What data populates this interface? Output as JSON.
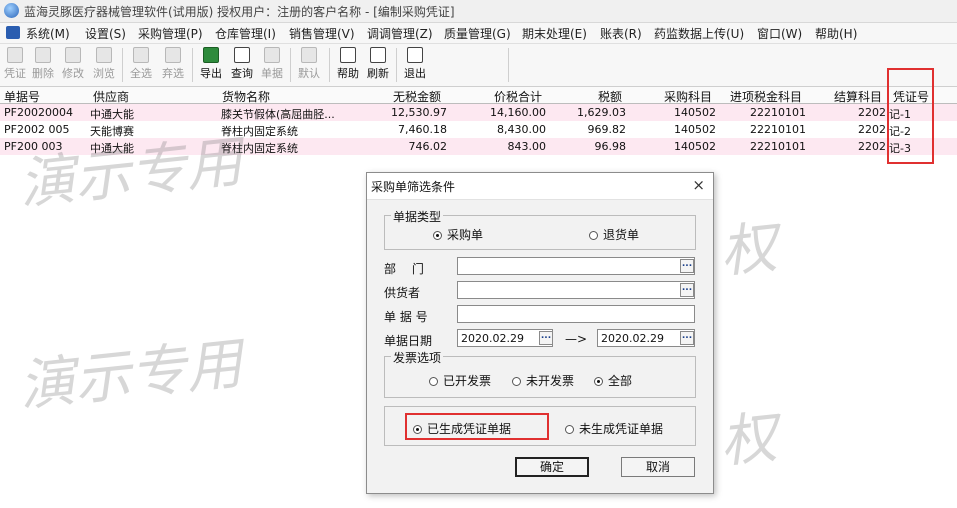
{
  "window": {
    "title": "蓝海灵豚医疗器械管理软件(试用版)    授权用户：注册的客户名称 - [编制采购凭证]"
  },
  "menubar": {
    "items": [
      "系统(M)",
      "设置(S)",
      "采购管理(P)",
      "仓库管理(I)",
      "销售管理(V)",
      "调调管理(Z)",
      "质量管理(G)",
      "期末处理(E)",
      "账表(R)",
      "药监数据上传(U)",
      "窗口(W)",
      "帮助(H)"
    ]
  },
  "toolbar": {
    "buttons": [
      {
        "label": "凭证",
        "icon": "voucher-icon",
        "enabled": false
      },
      {
        "label": "删除",
        "icon": "delete-icon",
        "enabled": false
      },
      {
        "label": "修改",
        "icon": "edit-icon",
        "enabled": false
      },
      {
        "label": "浏览",
        "icon": "browse-icon",
        "enabled": false
      },
      {
        "label": "全选",
        "icon": "select-all-icon",
        "enabled": false
      },
      {
        "label": "弃选",
        "icon": "deselect-icon",
        "enabled": false
      },
      {
        "label": "导出",
        "icon": "excel-icon",
        "enabled": true
      },
      {
        "label": "查询",
        "icon": "binoculars-icon",
        "enabled": true
      },
      {
        "label": "单据",
        "icon": "document-icon",
        "enabled": false
      },
      {
        "label": "默认",
        "icon": "default-icon",
        "enabled": false
      },
      {
        "label": "帮助",
        "icon": "help-icon",
        "enabled": true
      },
      {
        "label": "刷新",
        "icon": "refresh-icon",
        "enabled": true
      },
      {
        "label": "退出",
        "icon": "exit-icon",
        "enabled": true
      }
    ]
  },
  "grid": {
    "columns": [
      "单据号",
      "供应商",
      "货物名称",
      "无税金额",
      "价税合计",
      "税额",
      "采购科目",
      "进项税金科目",
      "结算科目",
      "凭证号"
    ],
    "rows": [
      [
        "PF20020004",
        "中通大能",
        "膝关节假体(高屈曲胫...",
        "12,530.97",
        "14,160.00",
        "1,629.03",
        "140502",
        "22210101",
        "2202",
        "记-1"
      ],
      [
        "PF2002 005",
        "天能博赛",
        "脊柱内固定系统",
        "7,460.18",
        "8,430.00",
        "969.82",
        "140502",
        "22210101",
        "2202",
        "记-2"
      ],
      [
        "PF200 003",
        "中通大能",
        "脊柱内固定系统",
        "746.02",
        "843.00",
        "96.98",
        "140502",
        "22210101",
        "2202",
        "记-3"
      ]
    ]
  },
  "watermark": {
    "text": "演示专用",
    "text2": "权"
  },
  "dialog": {
    "title": "采购单筛选条件",
    "close": "×",
    "doc_type": {
      "legend": "单据类型",
      "options": [
        "采购单",
        "退货单"
      ],
      "selected": 0
    },
    "fields": {
      "dept_label": "部　 门",
      "dept_value": "",
      "supplier_label": "供货者",
      "supplier_value": "",
      "docno_label": "单 据 号",
      "docno_value": "",
      "date_label": "单据日期",
      "date_from": "2020.02.29",
      "date_to": "2020.02.29",
      "arrow": "—>"
    },
    "invoice": {
      "legend": "发票选项",
      "options": [
        "已开发票",
        "未开发票",
        "全部"
      ],
      "selected": 2
    },
    "voucher": {
      "options": [
        "已生成凭证单据",
        "未生成凭证单据"
      ],
      "selected": 0
    },
    "buttons": {
      "ok": "确定",
      "cancel": "取消"
    }
  },
  "colors": {
    "highlight_red": "#e03030",
    "row_pink": "#fde8f1"
  }
}
